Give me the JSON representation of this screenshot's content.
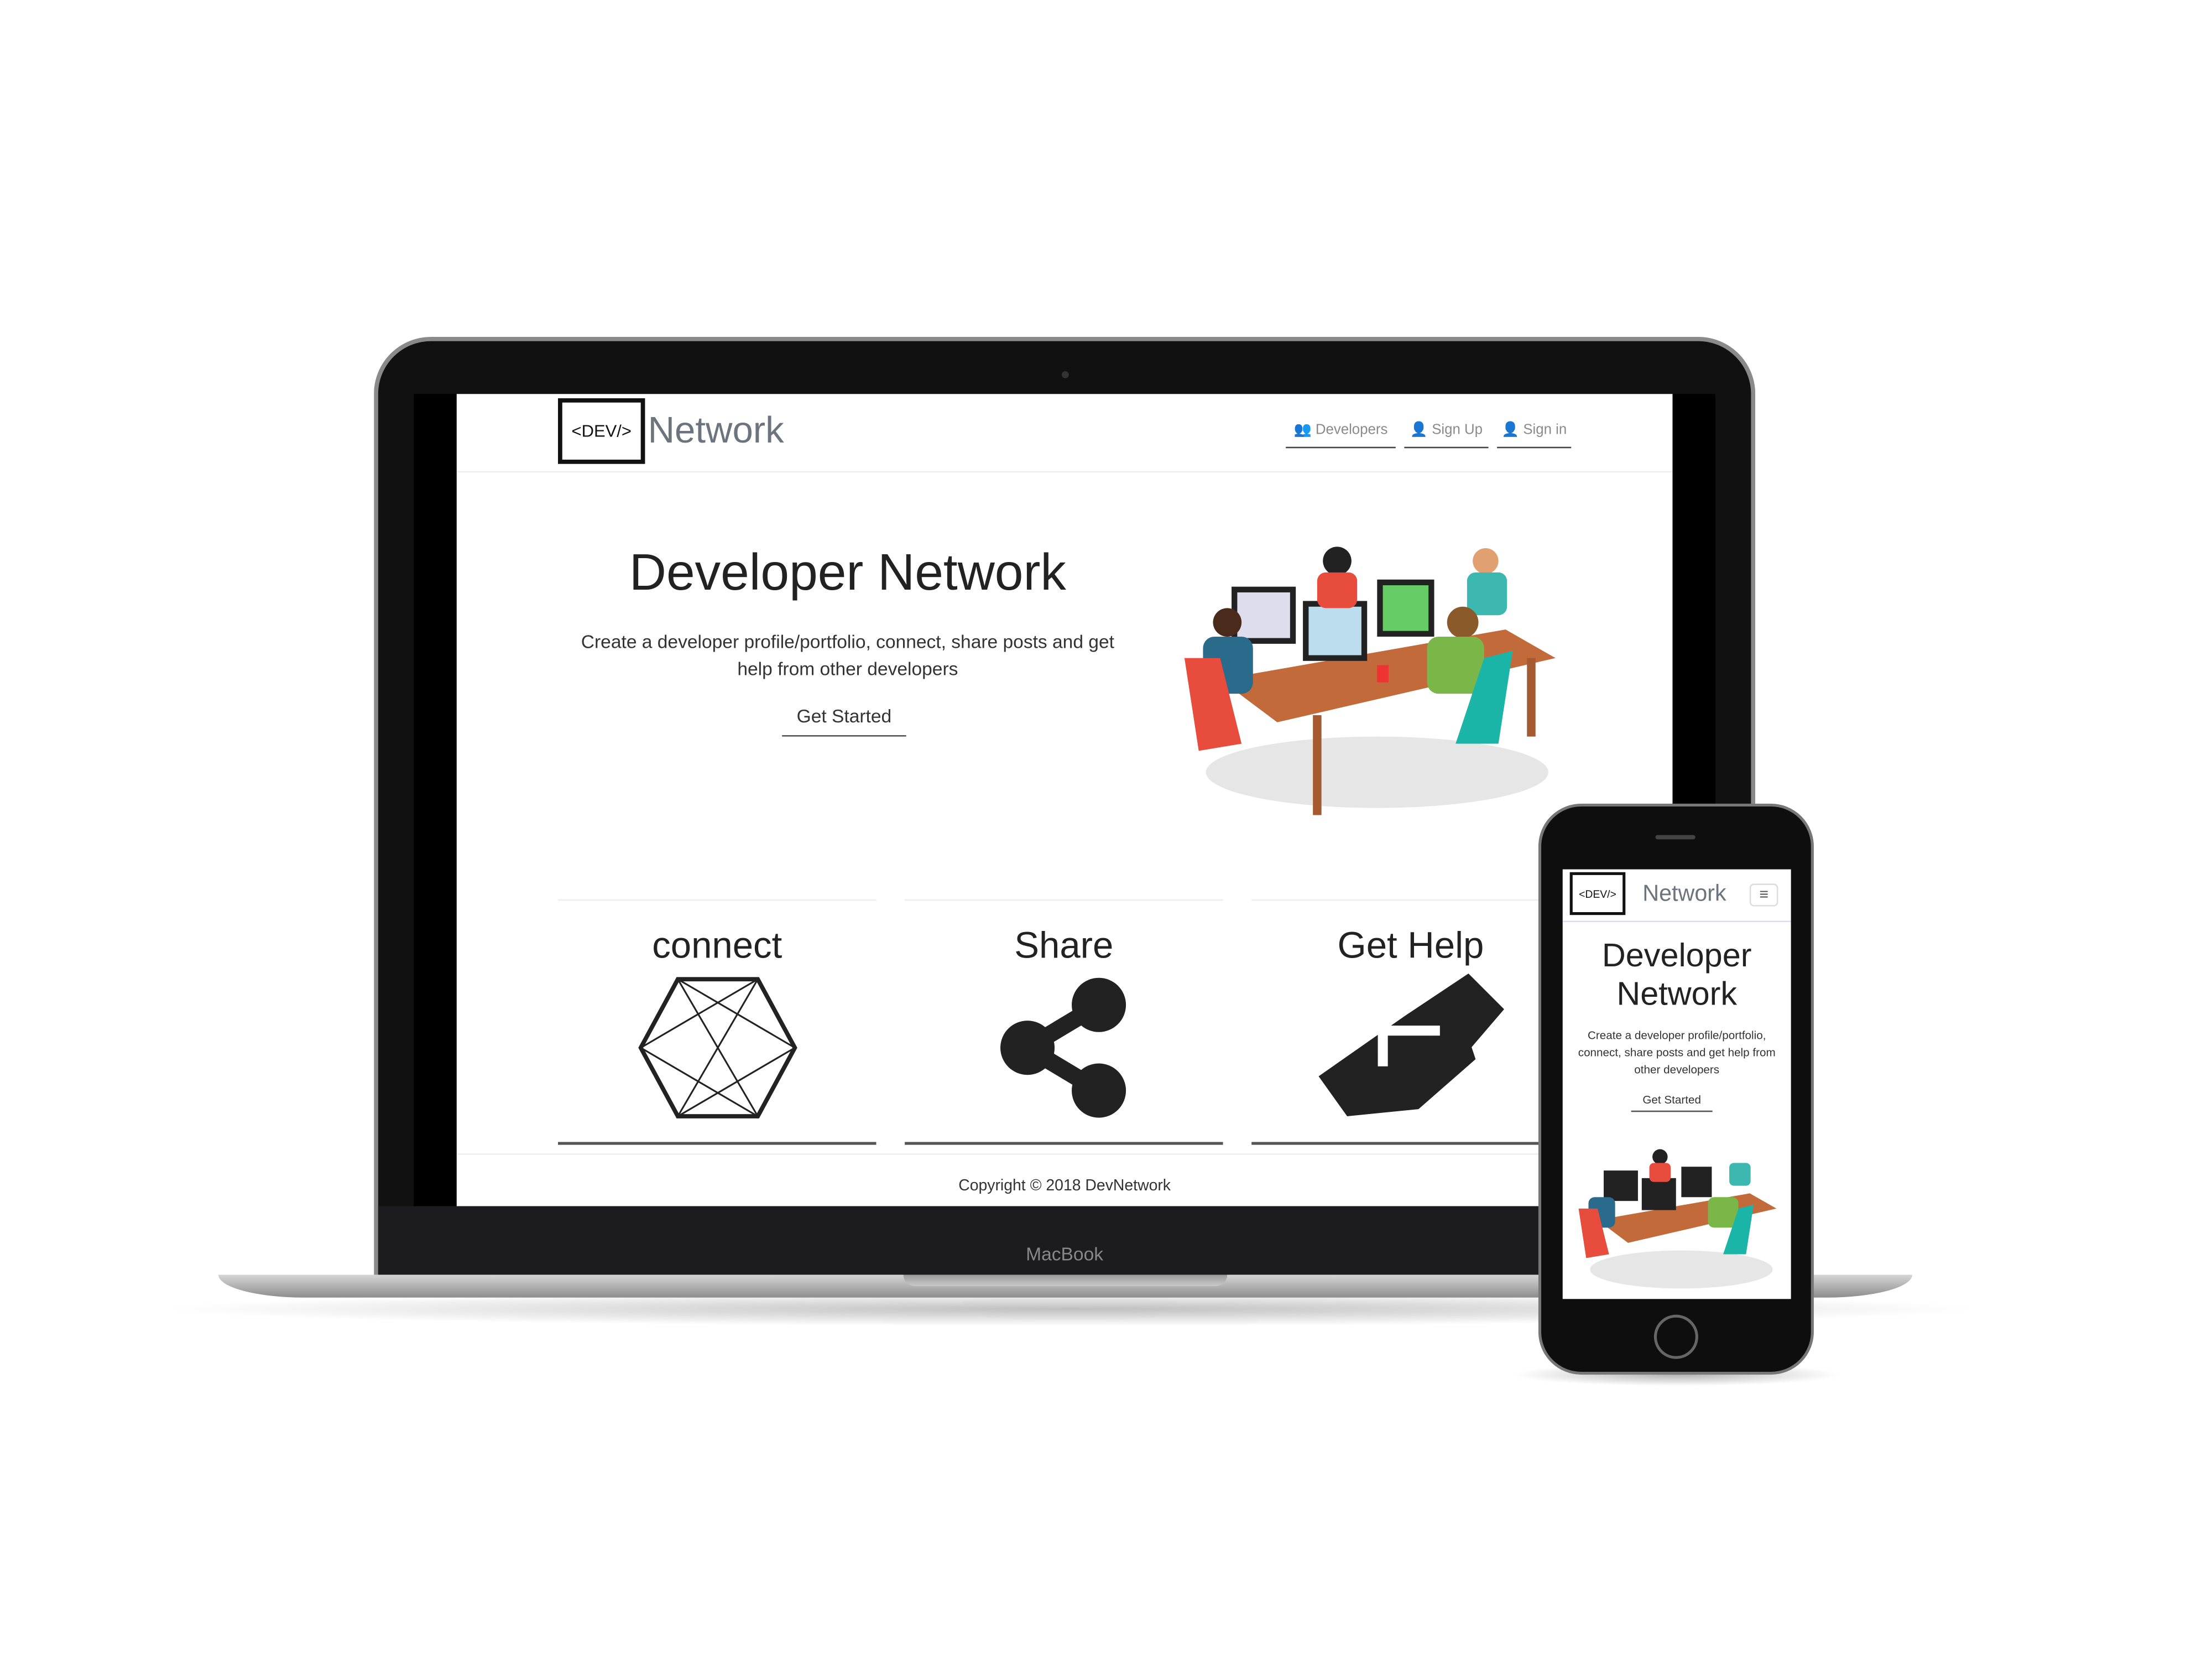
{
  "site": {
    "logo_text": "<DEV/>",
    "brand": "Network",
    "nav": [
      {
        "label": "Developers",
        "icon": "users-icon"
      },
      {
        "label": "Sign Up",
        "icon": "user-plus-icon"
      },
      {
        "label": "Sign in",
        "icon": "user-icon"
      }
    ],
    "hero": {
      "title": "Developer Network",
      "subtitle": "Create a developer profile/portfolio, connect, share posts and get help from other developers",
      "cta": "Get Started"
    },
    "features": [
      {
        "title": "connect",
        "icon": "hexagon-network-icon"
      },
      {
        "title": "Share",
        "icon": "share-icon"
      },
      {
        "title": "Get Help",
        "icon": "handshake-icon"
      }
    ],
    "footer": "Copyright © 2018 DevNetwork"
  },
  "device": {
    "laptop_label": "MacBook"
  },
  "colors": {
    "brand": "#6c757d",
    "text": "#222222"
  }
}
